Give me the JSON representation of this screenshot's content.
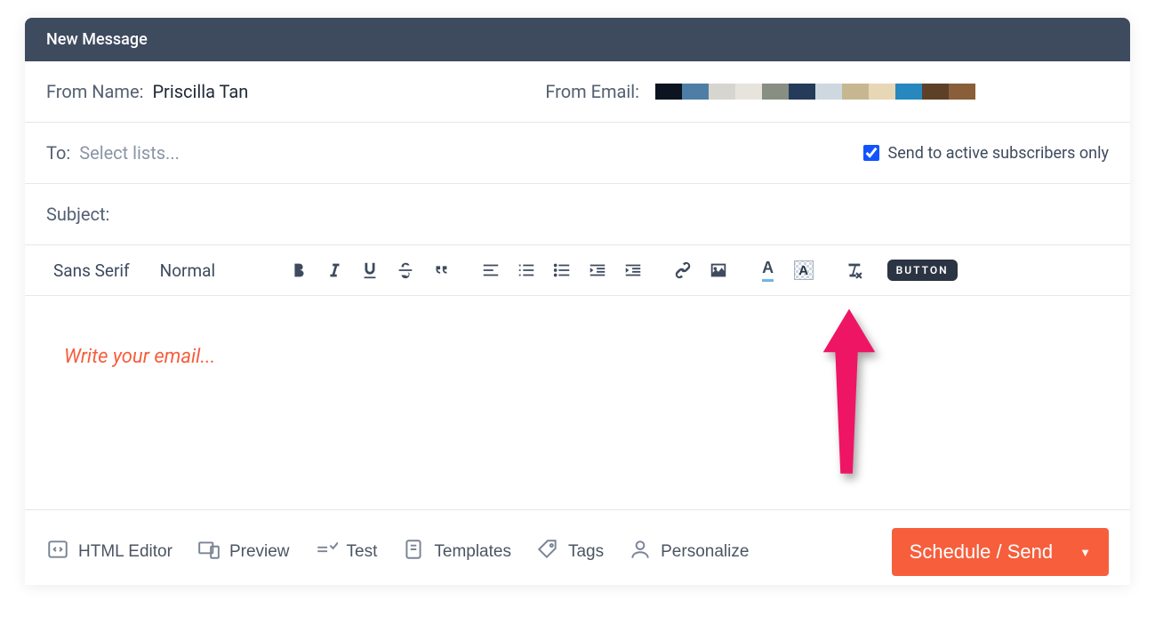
{
  "header": {
    "title": "New Message"
  },
  "from": {
    "name_label": "From Name:",
    "name_value": "Priscilla Tan",
    "email_label": "From Email:"
  },
  "to": {
    "label": "To:",
    "placeholder": "Select lists...",
    "active_only_label": "Send to active subscribers only",
    "active_only_checked": true
  },
  "subject": {
    "label": "Subject:"
  },
  "toolbar": {
    "font_family": "Sans Serif",
    "font_size": "Normal",
    "button_chip": "BUTTON"
  },
  "editor": {
    "placeholder": "Write your email..."
  },
  "footer": {
    "html_editor": "HTML Editor",
    "preview": "Preview",
    "test": "Test",
    "templates": "Templates",
    "tags": "Tags",
    "personalize": "Personalize",
    "schedule": "Schedule / Send"
  }
}
